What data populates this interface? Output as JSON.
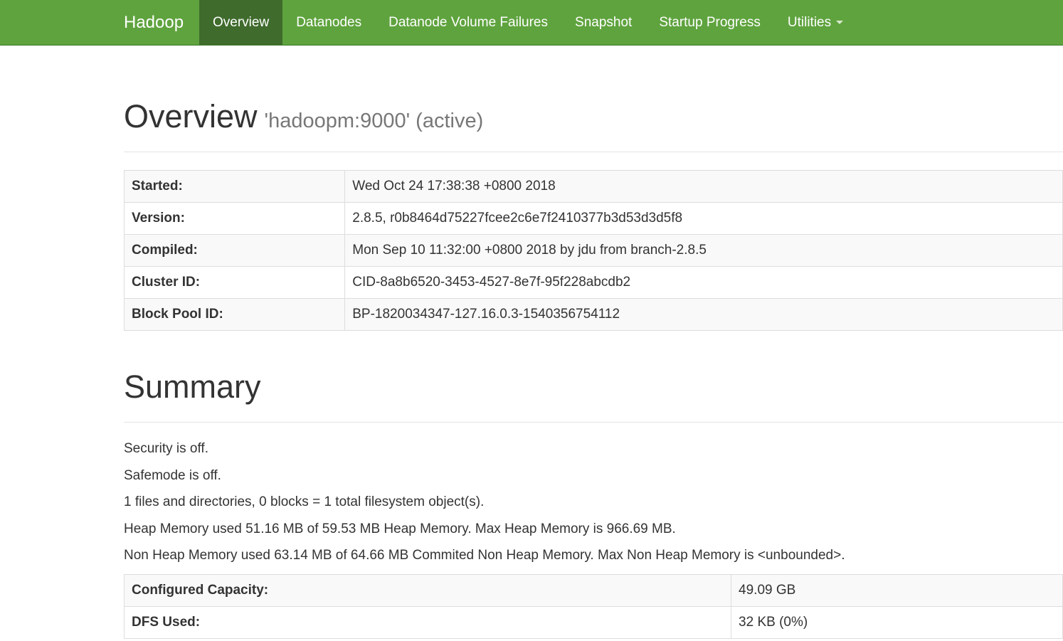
{
  "navbar": {
    "brand": "Hadoop",
    "items": [
      {
        "label": "Overview"
      },
      {
        "label": "Datanodes"
      },
      {
        "label": "Datanode Volume Failures"
      },
      {
        "label": "Snapshot"
      },
      {
        "label": "Startup Progress"
      },
      {
        "label": "Utilities"
      }
    ]
  },
  "overview": {
    "title": "Overview",
    "subtitle": "'hadoopm:9000' (active)",
    "rows": [
      {
        "key": "Started:",
        "value": "Wed Oct 24 17:38:38 +0800 2018"
      },
      {
        "key": "Version:",
        "value": "2.8.5, r0b8464d75227fcee2c6e7f2410377b3d53d3d5f8"
      },
      {
        "key": "Compiled:",
        "value": "Mon Sep 10 11:32:00 +0800 2018 by jdu from branch-2.8.5"
      },
      {
        "key": "Cluster ID:",
        "value": "CID-8a8b6520-3453-4527-8e7f-95f228abcdb2"
      },
      {
        "key": "Block Pool ID:",
        "value": "BP-1820034347-127.16.0.3-1540356754112"
      }
    ]
  },
  "summary": {
    "title": "Summary",
    "lines": [
      "Security is off.",
      "Safemode is off.",
      "1 files and directories, 0 blocks = 1 total filesystem object(s).",
      "Heap Memory used 51.16 MB of 59.53 MB Heap Memory. Max Heap Memory is 966.69 MB.",
      "Non Heap Memory used 63.14 MB of 64.66 MB Commited Non Heap Memory. Max Non Heap Memory is <unbounded>."
    ],
    "rows": [
      {
        "key": "Configured Capacity:",
        "value": "49.09 GB"
      },
      {
        "key": "DFS Used:",
        "value": "32 KB (0%)"
      }
    ]
  },
  "colors": {
    "navbar": "#5fa33e",
    "navbar_active": "#3f6b2d"
  }
}
